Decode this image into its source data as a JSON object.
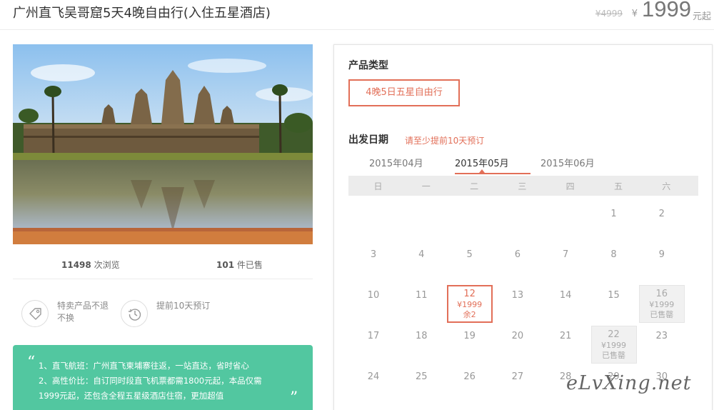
{
  "header": {
    "title": "广州直飞吴哥窟5天4晚自由行(入住五星酒店)",
    "old_price": "¥4999",
    "currency": "¥",
    "price": "1999",
    "price_unit": "元起"
  },
  "stats": {
    "views_count": "11498",
    "views_label": "次浏览",
    "sold_count": "101",
    "sold_label": "件已售"
  },
  "features": [
    {
      "icon": "price-tag-icon",
      "text": "特卖产品不退不换"
    },
    {
      "icon": "clock-history-icon",
      "text": "提前10天预订"
    }
  ],
  "promo": {
    "lines": [
      "1、直飞航班：广州直飞柬埔寨往返，一站直达，省时省心",
      "2、高性价比：自订同时段直飞机票都需1800元起，本品仅需",
      "1999元起，还包含全程五星级酒店住宿，更加超值"
    ]
  },
  "product_type": {
    "label": "产品类型",
    "option": "4晚5日五星自由行"
  },
  "departure": {
    "label": "出发日期",
    "hint": "请至少提前10天预订"
  },
  "calendar": {
    "months": [
      "2015年04月",
      "2015年05月",
      "2015年06月"
    ],
    "selected_month": "2015年05月",
    "weekdays": [
      "日",
      "一",
      "二",
      "三",
      "四",
      "五",
      "六"
    ],
    "days": [
      {
        "day": "1"
      },
      {
        "day": "2"
      },
      {
        "day": "3"
      },
      {
        "day": "4"
      },
      {
        "day": "5"
      },
      {
        "day": "6"
      },
      {
        "day": "7"
      },
      {
        "day": "8"
      },
      {
        "day": "9"
      },
      {
        "day": "10"
      },
      {
        "day": "11"
      },
      {
        "day": "12",
        "price": "¥1999",
        "status": "余2",
        "state": "selected"
      },
      {
        "day": "13"
      },
      {
        "day": "14"
      },
      {
        "day": "15"
      },
      {
        "day": "16",
        "price": "¥1999",
        "status": "已售罄",
        "state": "sold-out"
      },
      {
        "day": "17"
      },
      {
        "day": "18"
      },
      {
        "day": "19"
      },
      {
        "day": "20"
      },
      {
        "day": "21"
      },
      {
        "day": "22",
        "price": "¥1999",
        "status": "已售罄",
        "state": "sold-out"
      },
      {
        "day": "23"
      },
      {
        "day": "24"
      },
      {
        "day": "25"
      },
      {
        "day": "26"
      },
      {
        "day": "27"
      },
      {
        "day": "28"
      },
      {
        "day": "29"
      },
      {
        "day": "30"
      }
    ]
  },
  "watermark": "eLvXing.net",
  "colors": {
    "accent": "#e26f58",
    "promo_bg": "#52c7a0"
  }
}
